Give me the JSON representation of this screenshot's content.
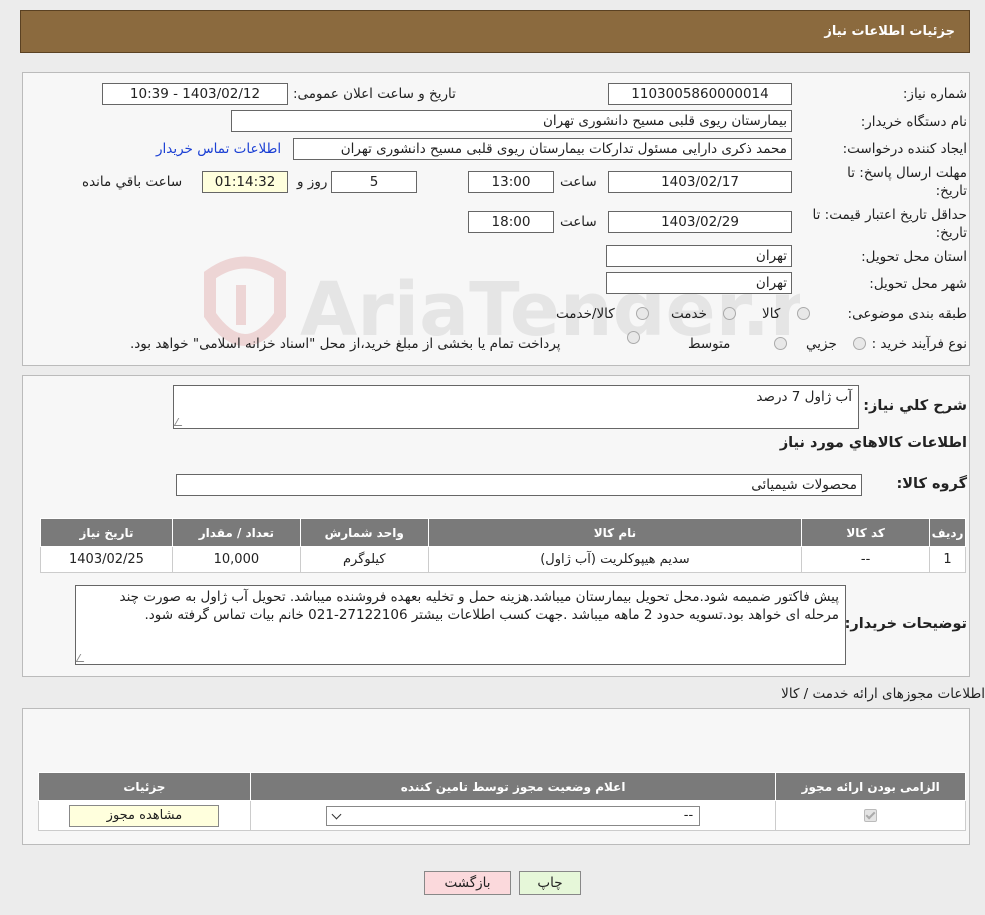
{
  "header": {
    "title": "جزئیات اطلاعات نیاز"
  },
  "info": {
    "need_number_label": "شماره نیاز:",
    "need_number": "1103005860000014",
    "announce_label": "تاریخ و ساعت اعلان عمومی:",
    "announce_value": "1403/02/12 - 10:39",
    "buyer_label": "نام دستگاه خریدار:",
    "buyer_value": "بیمارستان ریوی قلبی مسیح دانشوری تهران",
    "creator_label": "ایجاد کننده درخواست:",
    "creator_value": "محمد ذکری دارایی مسئول تداركات بیمارستان ریوی قلبی مسیح دانشوری تهران",
    "contact_link": "اطلاعات تماس خریدار",
    "deadline_label_1": "مهلت ارسال پاسخ: تا",
    "deadline_label_2": "تاریخ:",
    "deadline_date": "1403/02/17",
    "time_label": "ساعت",
    "deadline_time": "13:00",
    "days_value": "5",
    "days_label": "روز و",
    "remaining_time": "01:14:32",
    "remaining_label": "ساعت باقي مانده",
    "validity_label_1": "حداقل تاریخ اعتبار قیمت: تا",
    "validity_label_2": "تاریخ:",
    "validity_date": "1403/02/29",
    "validity_time": "18:00",
    "province_label": "استان محل تحویل:",
    "province_value": "تهران",
    "city_label": "شهر محل تحویل:",
    "city_value": "تهران",
    "category_label": "طبقه بندی موضوعی:",
    "category_options": [
      "کالا",
      "خدمت",
      "کالا/خدمت"
    ],
    "process_label": "نوع فرآیند خرید :",
    "process_options": [
      "جزیي",
      "متوسط"
    ],
    "process_note": "پرداخت تمام یا بخشی از مبلغ خرید،از محل \"اسناد خزانه اسلامی\" خواهد بود."
  },
  "summary": {
    "description_label": "شرح كلي نياز:",
    "description_value": "آب ژاول 7 درصد",
    "goods_title": "اطلاعات كالاهاي مورد نياز",
    "group_label": "گروه كالا:",
    "group_value": "محصولات شیمیائی",
    "table": {
      "headers": [
        "رديف",
        "كد كالا",
        "نام كالا",
        "واحد شمارش",
        "تعداد / مقدار",
        "تاريخ نياز"
      ],
      "rows": [
        [
          "1",
          "--",
          "سدیم هیپوکلریت (آب ژاول)",
          "کیلوگرم",
          "10,000",
          "1403/02/25"
        ]
      ]
    },
    "buyer_notes_label": "توضیحات خریدار:",
    "buyer_notes_value": "پیش فاکتور ضمیمه شود.محل تحویل بیمارستان میباشد.هزینه حمل و تخلیه بعهده فروشنده میباشد. تحویل آب ژاول به صورت چند مرحله ای خواهد بود.تسویه حدود 2 ماهه میباشد .جهت کسب اطلاعات بیشتر 27122106-021 خانم بیات تماس گرفته شود."
  },
  "licenses": {
    "title": "اطلاعات مجوزهای ارائه خدمت / کالا",
    "headers": [
      "الزامی بودن ارائه مجوز",
      "اعلام وضعیت مجوز توسط تامین کننده",
      "جزئیات"
    ],
    "select_value": "--",
    "view_button": "مشاهده مجوز"
  },
  "footer": {
    "print_button": "چاپ",
    "back_button": "بازگشت"
  },
  "watermark": {
    "text": "AriaTender.neT"
  },
  "colors": {
    "header_bg": "#8b6a3e",
    "link": "#1a3fd4",
    "table_header": "#7a7a7a"
  }
}
